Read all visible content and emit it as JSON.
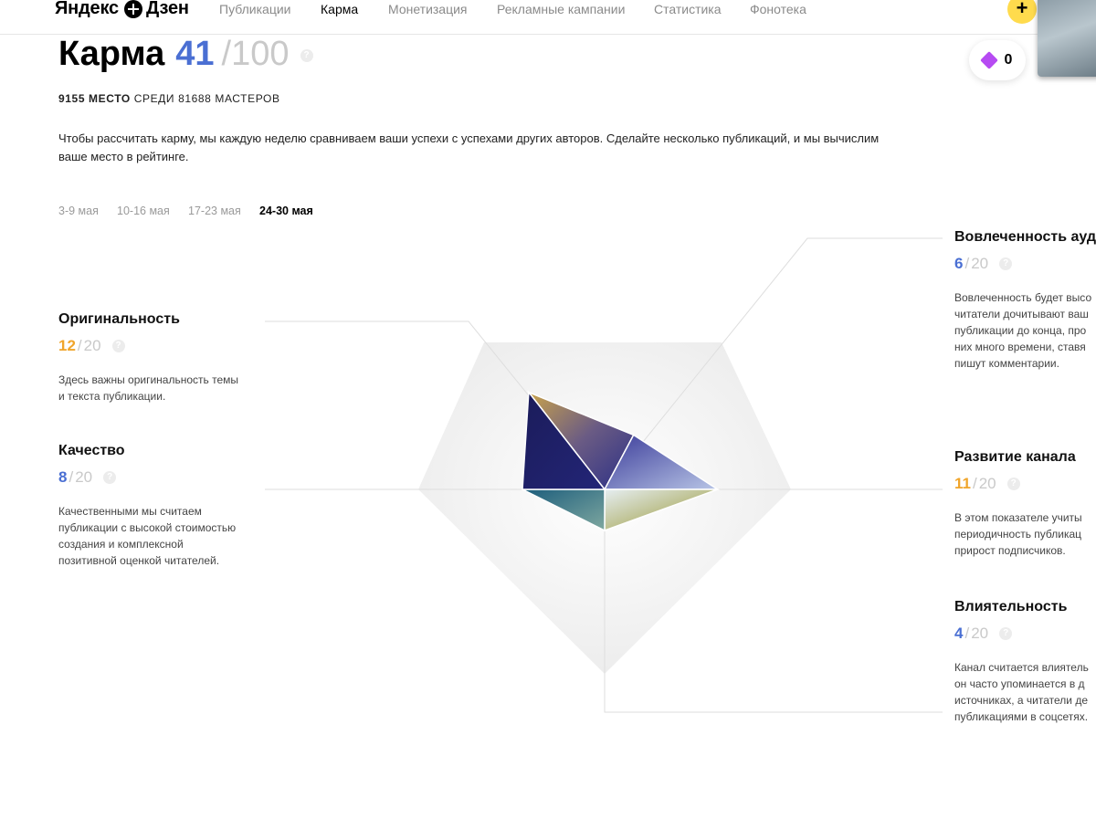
{
  "header": {
    "logo": "Яндекс",
    "logo_second": "Дзен",
    "nav": [
      "Публикации",
      "Карма",
      "Монетизация",
      "Рекламные кампании",
      "Статистика",
      "Фонотека"
    ],
    "active_nav": "Карма",
    "plus_label": "+"
  },
  "karma": {
    "title": "Карма",
    "score": "41",
    "max": "/100",
    "help": "?"
  },
  "coins": {
    "count": "0"
  },
  "rank": {
    "place": "9155 место",
    "rest": "среди 81688 мастеров"
  },
  "description": "Чтобы рассчитать карму, мы каждую неделю сравниваем ваши успехи с успехами других авторов. Сделайте несколько публикаций, и мы вычислим ваше место в рейтинге.",
  "weeks": [
    "3-9 мая",
    "10-16 мая",
    "17-23 мая",
    "24-30 мая"
  ],
  "active_week": "24-30 мая",
  "metrics": {
    "originality": {
      "title": "Оригинальность",
      "value": "12",
      "slash": "/",
      "max": "20",
      "help": "?",
      "text": [
        "Здесь важны оригинальность темы",
        "и текста публикации."
      ]
    },
    "quality": {
      "title": "Качество",
      "value": "8",
      "slash": "/",
      "max": "20",
      "help": "?",
      "text": [
        "Качественными мы считаем",
        "публикации с высокой стоимостью",
        "создания и комплексной",
        "позитивной оценкой читателей."
      ]
    },
    "engagement": {
      "title": "Вовлеченность ауд",
      "value": "6",
      "slash": "/",
      "max": "20",
      "help": "?",
      "text": [
        "Вовлеченность будет высо",
        "читатели дочитывают ваш",
        "публикации до конца, про",
        "них много времени, ставя",
        "пишут комментарии."
      ]
    },
    "growth": {
      "title": "Развитие канала",
      "value": "11",
      "slash": "/",
      "max": "20",
      "help": "?",
      "text": [
        "В этом показателе учиты",
        "периодичность публикац",
        "прирост подписчиков."
      ]
    },
    "influence": {
      "title": "Влиятельность",
      "value": "4",
      "slash": "/",
      "max": "20",
      "help": "?",
      "text": [
        "Канал считается влиятель",
        "он часто упоминается в д",
        "источниках, а читатели де",
        "публикациями в соцсетях."
      ]
    }
  },
  "chart_data": {
    "type": "radar",
    "axes": [
      "Вовлеченность ауд",
      "Развитие канала",
      "Влиятельность",
      "Качество",
      "Оригинальность"
    ],
    "values": [
      6,
      11,
      4,
      8,
      12
    ],
    "max": 20,
    "colors": {
      "accent_blue": "#4a6fd3",
      "accent_orange": "#f0a52b"
    }
  }
}
